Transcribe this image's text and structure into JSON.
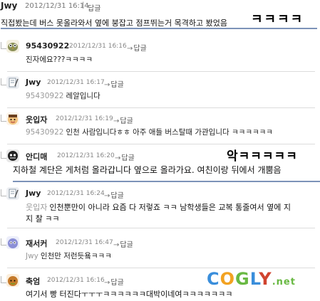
{
  "post": {
    "author": "Jwy",
    "date": "2012/12/31 16:14",
    "separator": "|",
    "reply": "답글",
    "body": "직접봤는데 버스 못올라와서 옆에 붕잡고 점프뛰는거 목격하고 봤었음",
    "overlay": "ㅋㅋㅋㅋ"
  },
  "comments": [
    {
      "author": "95430922",
      "date": "2012/12/31 16:16",
      "reply": "답글",
      "mention": "",
      "body": "진자에요???ㅋㅋㅋㅋ",
      "avatar_color": "#8a8f55"
    },
    {
      "author": "Jwy",
      "date": "2012/12/31 16:17",
      "reply": "답글",
      "mention": "95430922",
      "body": "레알입니다",
      "avatar_color": "#7f8c99"
    },
    {
      "author": "웃입자",
      "date": "2012/12/31 16:19",
      "reply": "답글",
      "mention": "95430922",
      "body": "인천 사람입니다ㅎㅎ 아주 애들 버스탈때 가관입니다 ㅋㅋㅋㅋㅋㅋ",
      "avatar_color": "#d48c4d"
    },
    {
      "author": "안디매",
      "date": "2012/12/31 16:20",
      "reply": "답글",
      "mention": "",
      "body": "지하철 계단은 게처럼 올라갑니다 옆으로 올라가요. 여친이랑 뒤에서 개뿜음",
      "avatar_color": "#222222",
      "overlay": "악ㅋㅋㅋㅋㅋ"
    },
    {
      "author": "Jwy",
      "date": "2012/12/31 16:24",
      "reply": "답글",
      "mention": "웃입자",
      "body": "인천뿐만이 아니라 요즘 다 저렇죠 ㅋㅋ 남학생들은 교복 통줄여서 옆에 지",
      "body2": "지 찰 ㅋㅋ",
      "avatar_color": "#7f8c99"
    },
    {
      "author": "재서커",
      "date": "2012/12/31 16:47",
      "reply": "답글",
      "mention": "Jwy",
      "body": "인천만 저런듯욬ㅋㅋㅋ",
      "avatar_color": "#8b8fd6"
    },
    {
      "author": "축엄",
      "date": "2012/12/31 16:16",
      "reply": "답글",
      "mention": "",
      "body": "여기서 빵 터진다ㅜㅜㅜㅋㅋㅋㅋㅋㅋ대박이네여ㅋㅋㅋㅋㅋㅋㅋ",
      "avatar_color": "#c57a2a"
    }
  ],
  "logo": {
    "c": "C",
    "o": "O",
    "g": "G",
    "l": "L",
    "y": "Y",
    "dot": ".net"
  }
}
